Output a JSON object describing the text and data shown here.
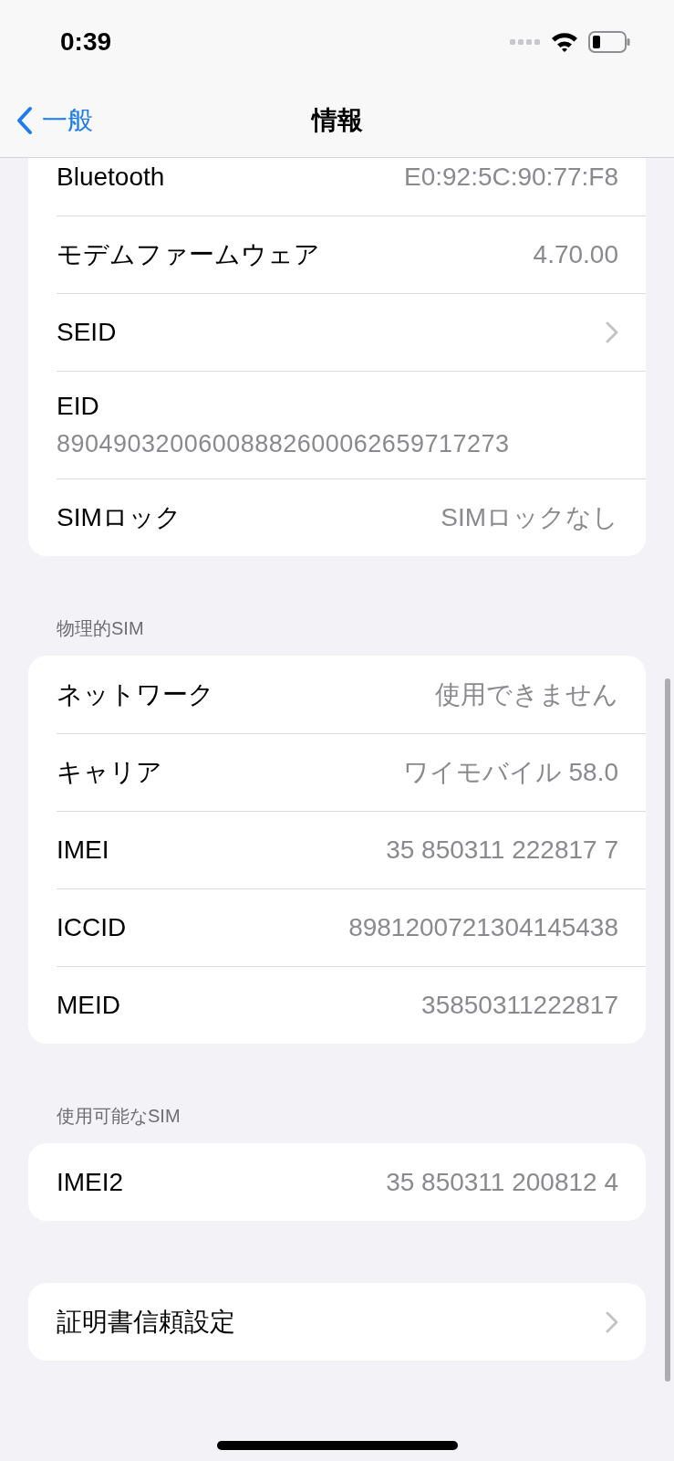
{
  "status_bar": {
    "time": "0:39"
  },
  "nav": {
    "back": "一般",
    "title": "情報"
  },
  "sections": [
    {
      "rows": [
        {
          "kind": "value",
          "label": "Bluetooth",
          "value": "E0:92:5C:90:77:F8"
        },
        {
          "kind": "value",
          "label": "モデムファームウェア",
          "value": "4.70.00"
        },
        {
          "kind": "link",
          "label": "SEID"
        },
        {
          "kind": "stacked",
          "label": "EID",
          "value": "89049032006008882600062659717273"
        },
        {
          "kind": "value",
          "label": "SIMロック",
          "value": "SIMロックなし"
        }
      ]
    },
    {
      "header": "物理的SIM",
      "rows": [
        {
          "kind": "value",
          "label": "ネットワーク",
          "value": "使用できません"
        },
        {
          "kind": "value",
          "label": "キャリア",
          "value": "ワイモバイル 58.0"
        },
        {
          "kind": "value",
          "label": "IMEI",
          "value": "35 850311 222817 7"
        },
        {
          "kind": "value",
          "label": "ICCID",
          "value": "8981200721304145438"
        },
        {
          "kind": "value",
          "label": "MEID",
          "value": "35850311222817"
        }
      ]
    },
    {
      "header": "使用可能なSIM",
      "rows": [
        {
          "kind": "value",
          "label": "IMEI2",
          "value": "35 850311 200812 4"
        }
      ]
    },
    {
      "rows": [
        {
          "kind": "link",
          "label": "証明書信頼設定"
        }
      ]
    }
  ]
}
